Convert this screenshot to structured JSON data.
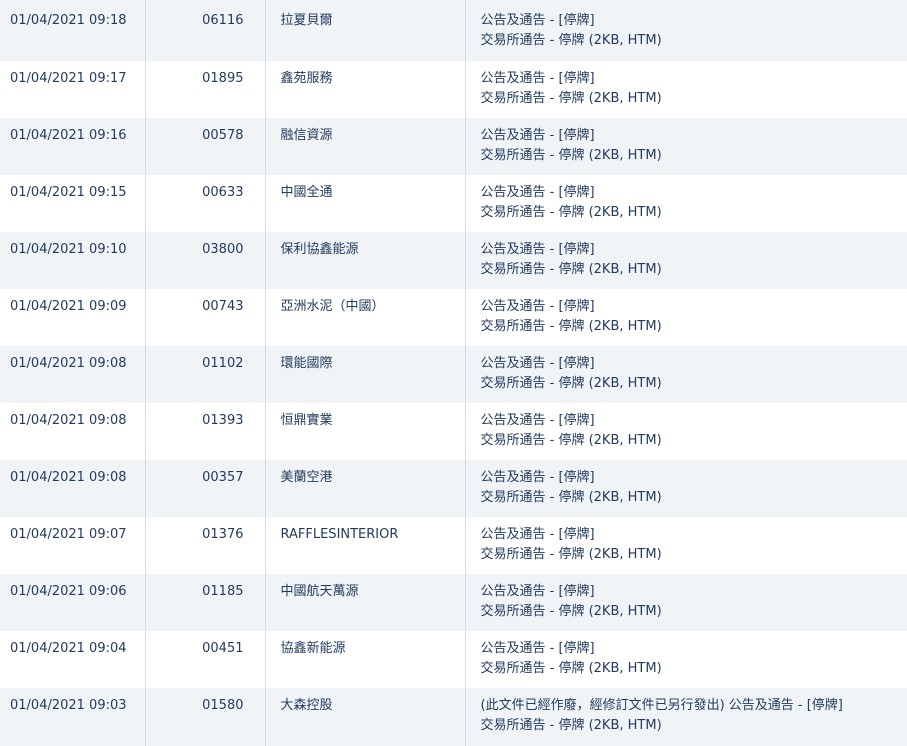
{
  "rows": [
    {
      "time": "01/04/2021 09:18",
      "code": "06116",
      "name": "拉夏貝爾",
      "line1": "公告及通告 - [停牌]",
      "line2": "交易所通告 - 停牌 (2KB, HTM)"
    },
    {
      "time": "01/04/2021 09:17",
      "code": "01895",
      "name": "鑫苑服務",
      "line1": "公告及通告 - [停牌]",
      "line2": "交易所通告 - 停牌 (2KB, HTM)"
    },
    {
      "time": "01/04/2021 09:16",
      "code": "00578",
      "name": "融信資源",
      "line1": "公告及通告 - [停牌]",
      "line2": "交易所通告 - 停牌 (2KB, HTM)"
    },
    {
      "time": "01/04/2021 09:15",
      "code": "00633",
      "name": "中國全通",
      "line1": "公告及通告 - [停牌]",
      "line2": "交易所通告 - 停牌 (2KB, HTM)"
    },
    {
      "time": "01/04/2021 09:10",
      "code": "03800",
      "name": "保利協鑫能源",
      "line1": "公告及通告 - [停牌]",
      "line2": "交易所通告 - 停牌 (2KB, HTM)"
    },
    {
      "time": "01/04/2021 09:09",
      "code": "00743",
      "name": "亞洲水泥（中國）",
      "line1": "公告及通告 - [停牌]",
      "line2": "交易所通告 - 停牌 (2KB, HTM)"
    },
    {
      "time": "01/04/2021 09:08",
      "code": "01102",
      "name": "環能國際",
      "line1": "公告及通告 - [停牌]",
      "line2": "交易所通告 - 停牌 (2KB, HTM)"
    },
    {
      "time": "01/04/2021 09:08",
      "code": "01393",
      "name": "恒鼎實業",
      "line1": "公告及通告 - [停牌]",
      "line2": "交易所通告 - 停牌 (2KB, HTM)"
    },
    {
      "time": "01/04/2021 09:08",
      "code": "00357",
      "name": "美蘭空港",
      "line1": "公告及通告 - [停牌]",
      "line2": "交易所通告 - 停牌 (2KB, HTM)"
    },
    {
      "time": "01/04/2021 09:07",
      "code": "01376",
      "name": "RAFFLESINTERIOR",
      "line1": "公告及通告 - [停牌]",
      "line2": "交易所通告 - 停牌 (2KB, HTM)"
    },
    {
      "time": "01/04/2021 09:06",
      "code": "01185",
      "name": "中國航天萬源",
      "line1": "公告及通告 - [停牌]",
      "line2": "交易所通告 - 停牌 (2KB, HTM)"
    },
    {
      "time": "01/04/2021 09:04",
      "code": "00451",
      "name": "協鑫新能源",
      "line1": "公告及通告 - [停牌]",
      "line2": "交易所通告 - 停牌 (2KB, HTM)"
    },
    {
      "time": "01/04/2021 09:03",
      "code": "01580",
      "name": "大森控股",
      "line1": "(此文件已經作廢，經修訂文件已另行發出) 公告及通告 - [停牌]",
      "line2": "交易所通告 - 停牌 (2KB, HTM)"
    }
  ]
}
